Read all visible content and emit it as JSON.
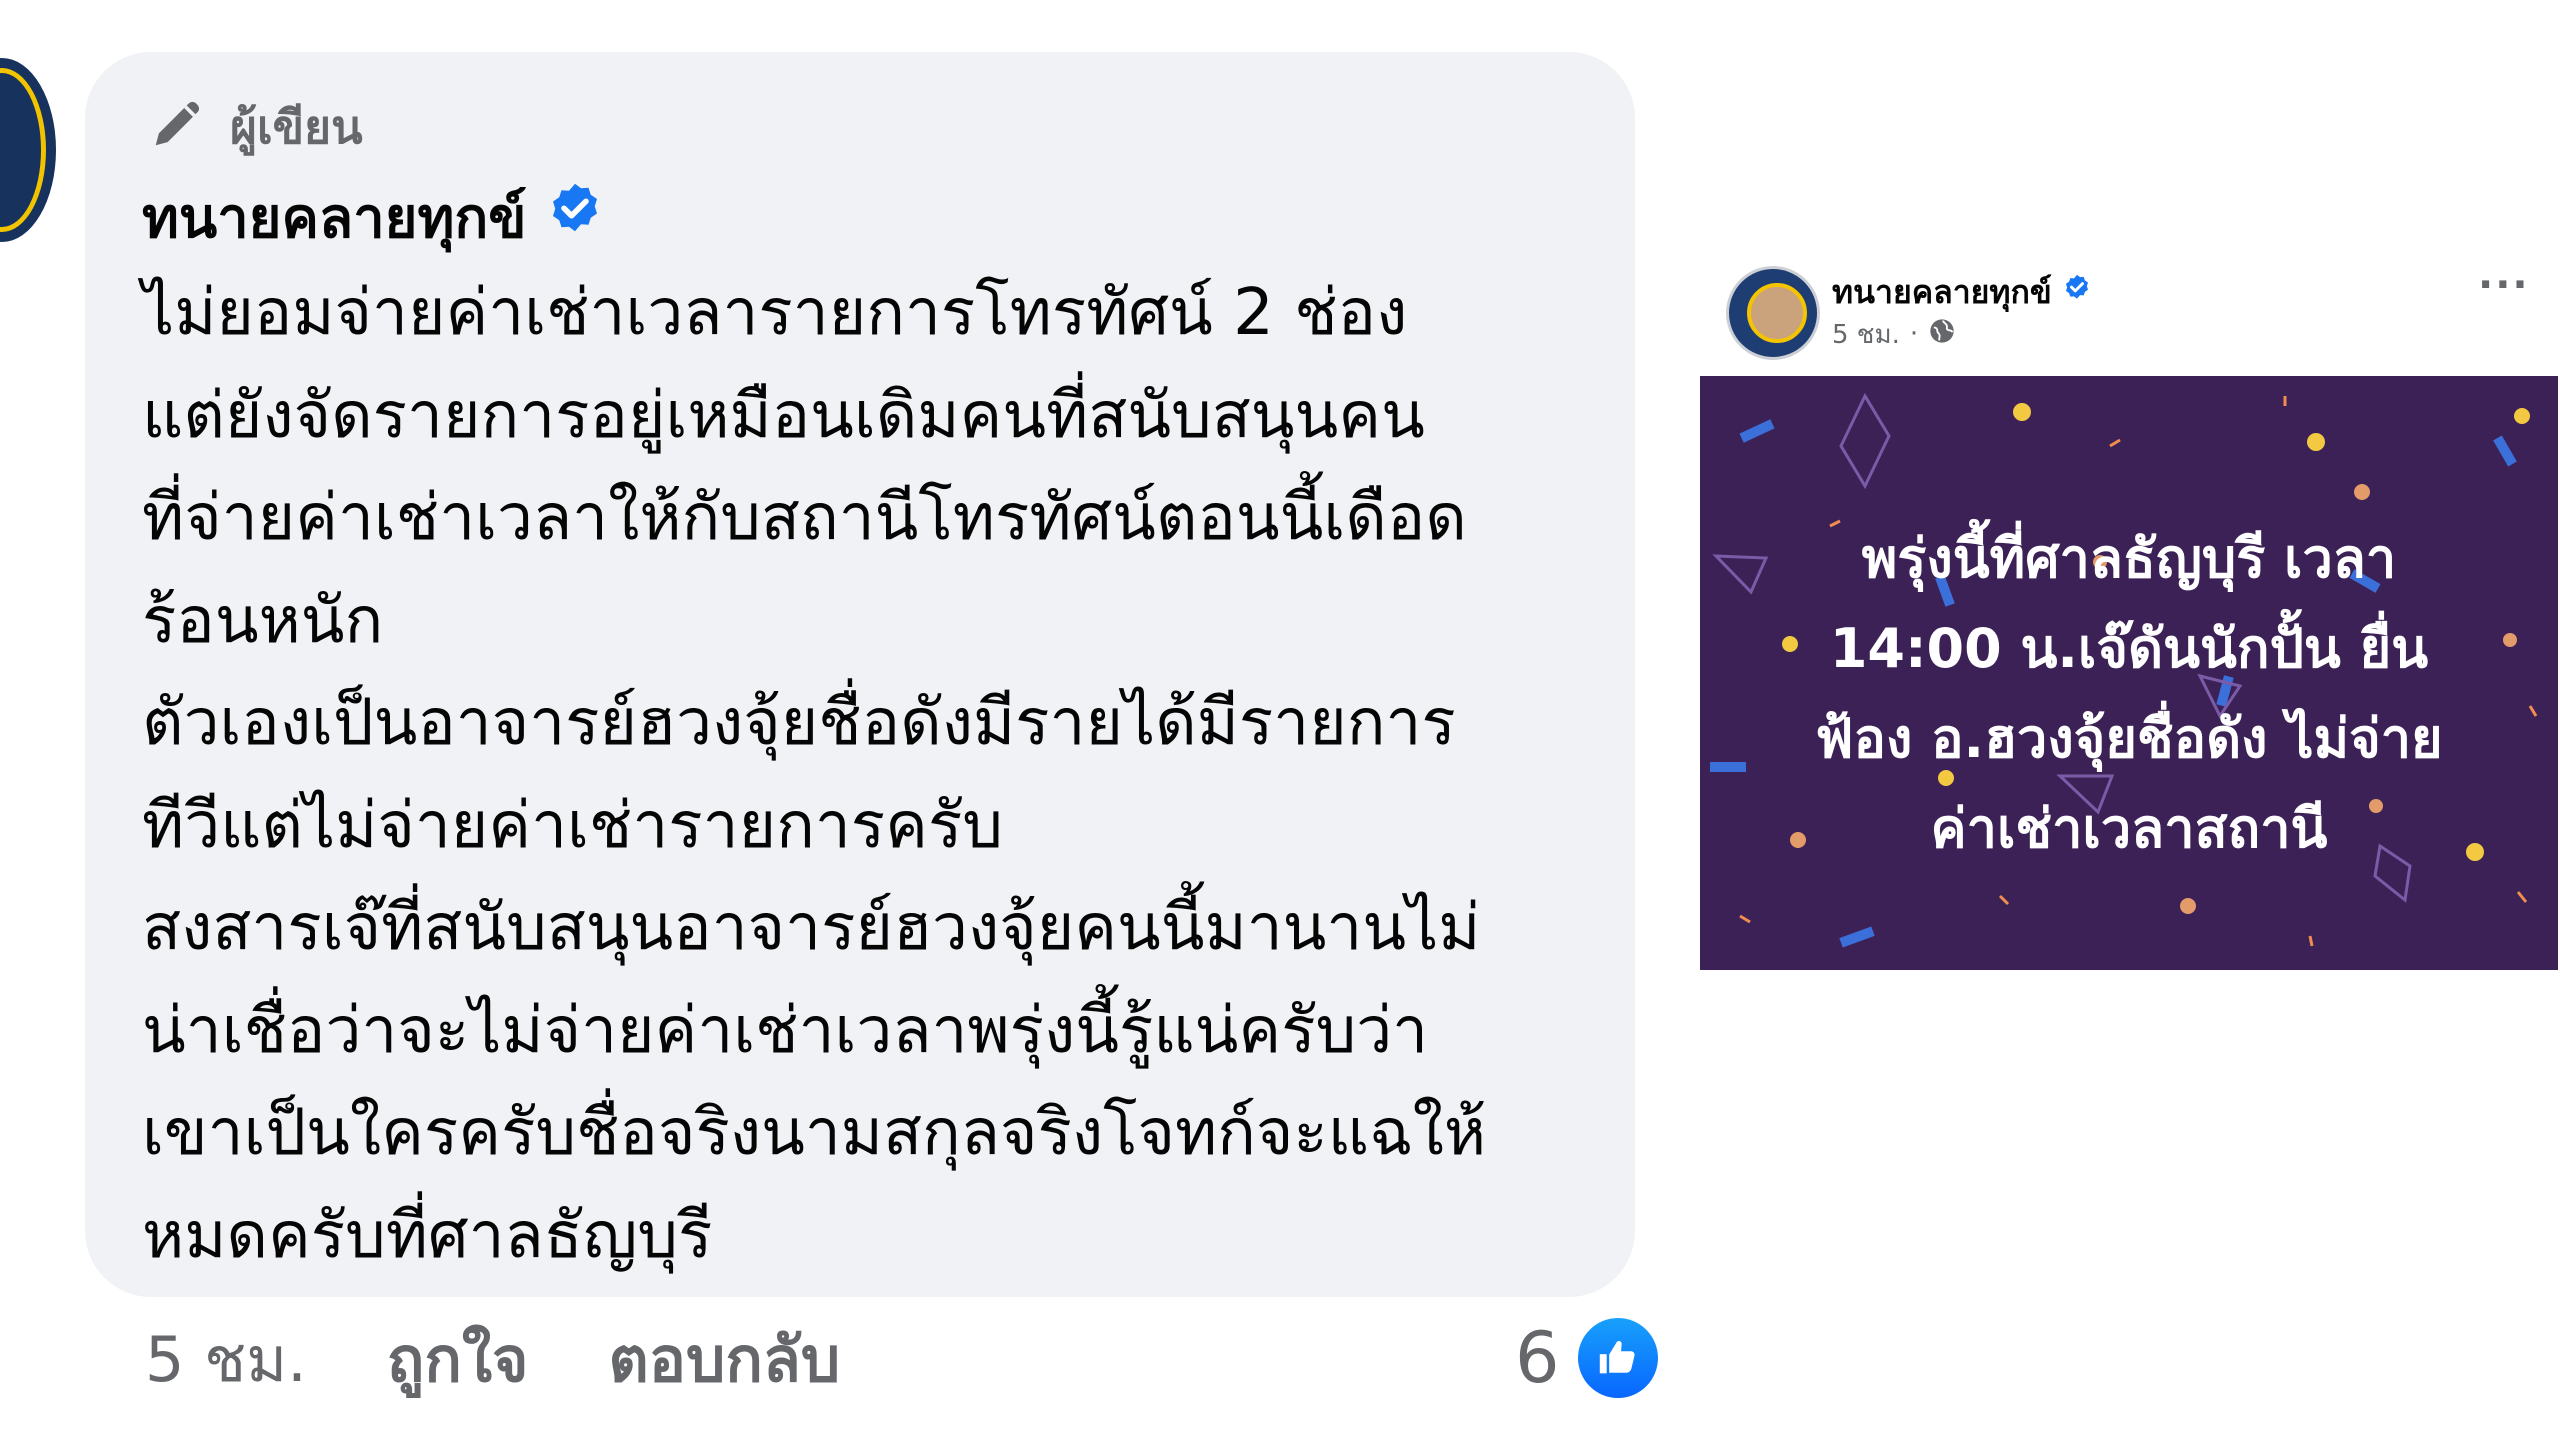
{
  "comment": {
    "badge_label": "ผู้เขียน",
    "author_name": "ทนายคลายทุกข์",
    "body_lines": [
      "ไม่ยอมจ่ายค่าเช่าเวลารายการโทรทัศน์ 2 ช่อง",
      "แต่ยังจัดรายการอยู่เหมือนเดิมคนที่สนับสนุนคน",
      "ที่จ่ายค่าเช่าเวลาให้กับสถานีโทรทัศน์ตอนนี้เดือด",
      "ร้อนหนัก",
      "ตัวเองเป็นอาจารย์ฮวงจุ้ยชื่อดังมีรายได้มีรายการ",
      "ทีวีแต่ไม่จ่ายค่าเช่ารายการครับ",
      "สงสารเจ๊ที่สนับสนุนอาจารย์ฮวงจุ้ยคนนี้มานานไม่",
      "น่าเชื่อว่าจะไม่จ่ายค่าเช่าเวลาพรุ่งนี้รู้แน่ครับว่า",
      "เขาเป็นใครครับชื่อจริงนามสกุลจริงโจทก์จะแฉให้",
      "หมดครับที่ศาลธัญบุรี"
    ],
    "time": "5 ชม.",
    "like_action": "ถูกใจ",
    "reply_action": "ตอบกลับ",
    "reaction_count": "6"
  },
  "shared_post": {
    "author_name": "ทนายคลายทุกข์",
    "time": "5 ชม.",
    "separator": "·",
    "more_label": "···",
    "image_caption_lines": [
      "พรุ่งนี้ที่ศาลธัญบุรี เวลา",
      "14:00 น.เจ๊ดันนักปั้น ยื่น",
      "ฟ้อง อ.ฮวงจุ้ยชื่อดัง ไม่จ่าย",
      "ค่าเช่าเวลาสถานี"
    ]
  },
  "colors": {
    "bubble": "#f0f2f5",
    "verified": "#1877f2",
    "like": "#0866ff",
    "post_image_bg": "#3c2156"
  },
  "icons": [
    "pen-icon",
    "verified-badge-icon",
    "like-thumb-icon",
    "globe-icon",
    "more-icon"
  ]
}
